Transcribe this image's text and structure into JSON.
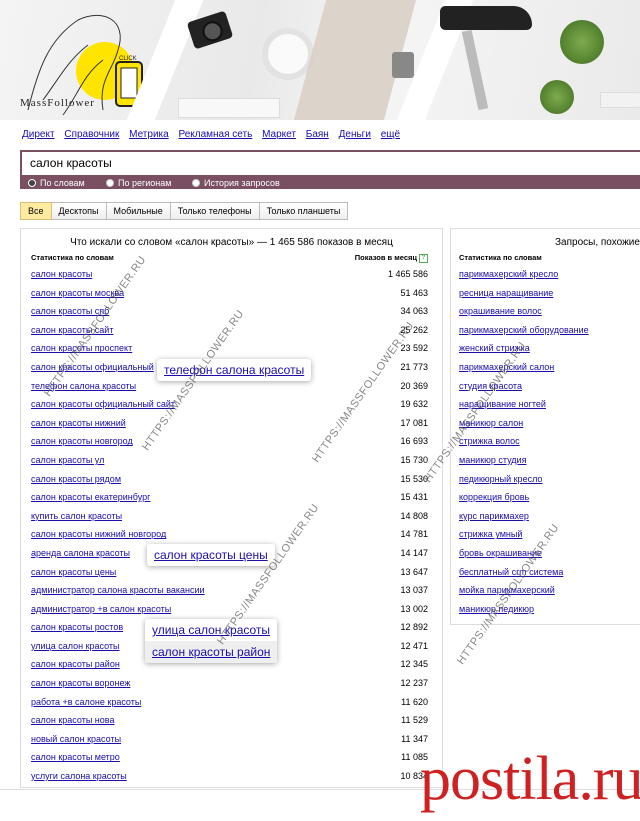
{
  "banner": {
    "brand": "MassFollower",
    "click_text": "CLICK"
  },
  "nav": [
    "Директ",
    "Справочник",
    "Метрика",
    "Рекламная сеть",
    "Маркет",
    "Баян",
    "Деньги",
    "ещё"
  ],
  "search": {
    "value": "салон красоты",
    "modes": [
      "По словам",
      "По регионам",
      "История запросов"
    ],
    "selected_mode": "По словам"
  },
  "tabs": [
    "Все",
    "Десктопы",
    "Мобильные",
    "Только телефоны",
    "Только планшеты"
  ],
  "left_panel": {
    "title": "Что искали со словом «салон красоты» — 1 465 586 показов в месяц",
    "col_query": "Статистика по словам",
    "col_count": "Показов в месяц",
    "help_icon": "?",
    "rows": [
      {
        "q": "салон красоты",
        "n": "1 465 586"
      },
      {
        "q": "салон красоты москва",
        "n": "51 463"
      },
      {
        "q": "салон красоты спб",
        "n": "34 063"
      },
      {
        "q": "салон красоты сайт",
        "n": "25 262"
      },
      {
        "q": "салон красоты проспект",
        "n": "23 592"
      },
      {
        "q": "салон красоты официальный",
        "n": "21 773"
      },
      {
        "q": "телефон салона красоты",
        "n": "20 369"
      },
      {
        "q": "салон красоты официальный сайт",
        "n": "19 632"
      },
      {
        "q": "салон красоты нижний",
        "n": "17 081"
      },
      {
        "q": "салон красоты новгород",
        "n": "16 693"
      },
      {
        "q": "салон красоты ул",
        "n": "15 730"
      },
      {
        "q": "салон красоты рядом",
        "n": "15 530"
      },
      {
        "q": "салон красоты екатеринбург",
        "n": "15 431"
      },
      {
        "q": "купить салон красоты",
        "n": "14 808"
      },
      {
        "q": "салон красоты нижний новгород",
        "n": "14 781"
      },
      {
        "q": "аренда салона красоты",
        "n": "14 147"
      },
      {
        "q": "салон красоты цены",
        "n": "13 647"
      },
      {
        "q": "администратор салона красоты вакансии",
        "n": "13 037"
      },
      {
        "q": "администратор +в салон красоты",
        "n": "13 002"
      },
      {
        "q": "салон красоты ростов",
        "n": "12 892"
      },
      {
        "q": "улица салон красоты",
        "n": "12 471"
      },
      {
        "q": "салон красоты район",
        "n": "12 345"
      },
      {
        "q": "салон красоты воронеж",
        "n": "12 237"
      },
      {
        "q": "работа +в салоне красоты",
        "n": "11 620"
      },
      {
        "q": "салон красоты нова",
        "n": "11 529"
      },
      {
        "q": "новый салон красоты",
        "n": "11 347"
      },
      {
        "q": "салон красоты метро",
        "n": "11 085"
      },
      {
        "q": "услуги салона красоты",
        "n": "10 834"
      }
    ]
  },
  "right_panel": {
    "title": "Запросы, похожие",
    "col_query": "Статистика по словам",
    "rows": [
      "парикмахерский кресло",
      "ресница наращивание",
      "окрашивание волос",
      "парикмахерский оборудование",
      "женский стрижка",
      "парикмахерский салон",
      "студия красота",
      "наращивание ногтей",
      "маникюр салон",
      "стрижка волос",
      "маникюр студия",
      "педикюрный кресло",
      "коррекция бровь",
      "курс парикмахер",
      "стрижка умный",
      "бровь окрашивание",
      "бесплатный crm система",
      "мойка парикмахерский",
      "маникюр педикюр"
    ]
  },
  "popups": {
    "p1": [
      "телефон салона красоты"
    ],
    "p2": [
      "салон красоты цены"
    ],
    "p3": [
      "улица салон красоты",
      "салон красоты район"
    ]
  },
  "watermark": "HTTPS://MASSFOLLOWER.RU",
  "footer": {
    "brand": "postila.ru"
  },
  "colors": {
    "accent": "#7a4f62",
    "link": "#1a0dab",
    "tab_active": "#ffeba0",
    "brand_red": "#cf2121"
  }
}
